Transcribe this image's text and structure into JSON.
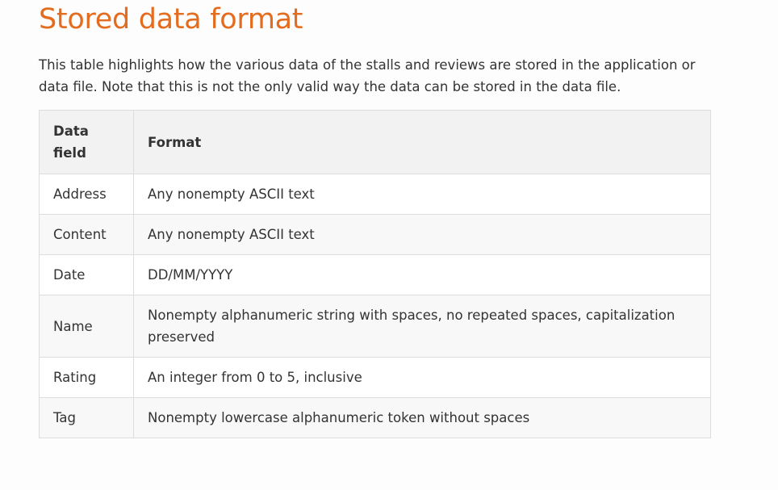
{
  "heading": "Stored data format",
  "intro": "This table highlights how the various data of the stalls and reviews are stored in the application or data file. Note that this is not the only valid way the data can be stored in the data file.",
  "table": {
    "headers": [
      "Data field",
      "Format"
    ],
    "rows": [
      [
        "Address",
        "Any nonempty ASCII text"
      ],
      [
        "Content",
        "Any nonempty ASCII text"
      ],
      [
        "Date",
        "DD/MM/YYYY"
      ],
      [
        "Name",
        "Nonempty alphanumeric string with spaces, no repeated spaces, capitalization preserved"
      ],
      [
        "Rating",
        "An integer from 0 to 5, inclusive"
      ],
      [
        "Tag",
        "Nonempty lowercase alphanumeric token without spaces"
      ]
    ]
  },
  "colors": {
    "heading": "#e46c1e",
    "text": "#333333",
    "border": "#dddddd",
    "header_bg": "#f2f2f2",
    "stripe_bg": "#f8f8f8"
  }
}
